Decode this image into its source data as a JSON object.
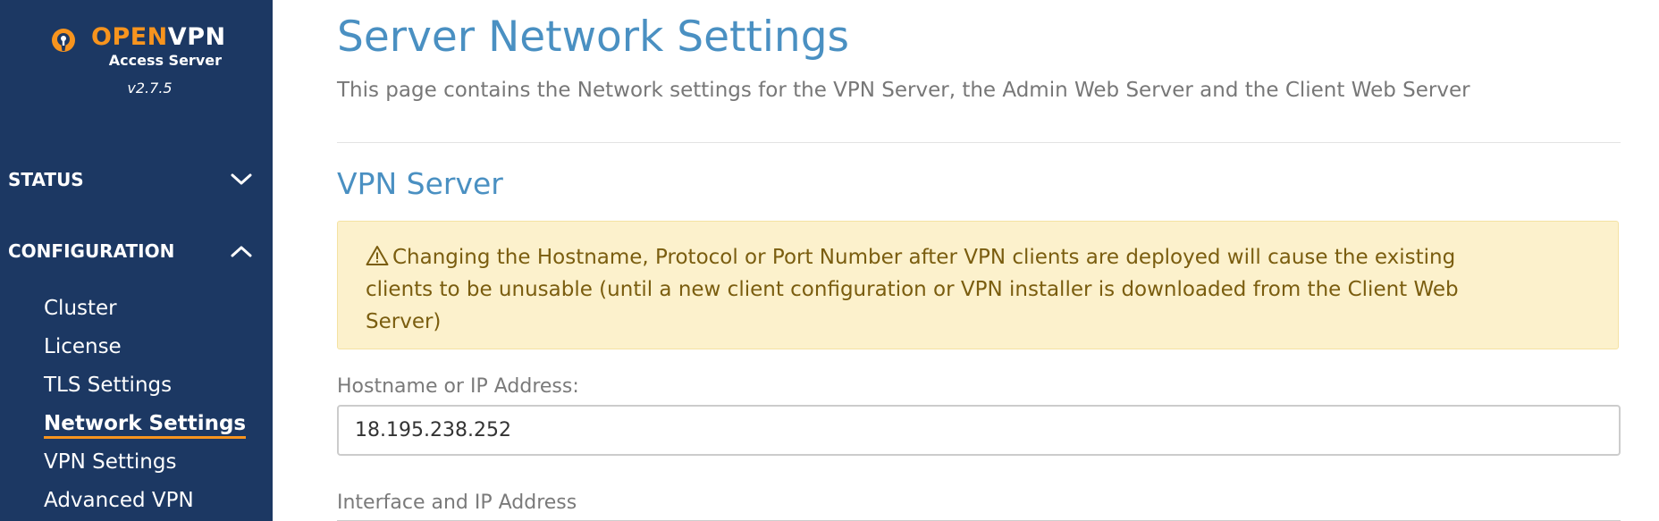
{
  "sidebar": {
    "brand": {
      "open": "OPEN",
      "vpn": "VPN",
      "subtitle": "Access Server",
      "version": "v2.7.5"
    },
    "sections": [
      {
        "label": "STATUS",
        "expanded": false
      },
      {
        "label": "CONFIGURATION",
        "expanded": true
      }
    ],
    "items": [
      {
        "label": "Cluster"
      },
      {
        "label": "License"
      },
      {
        "label": "TLS Settings"
      },
      {
        "label": "Network Settings",
        "active": true
      },
      {
        "label": "VPN Settings"
      },
      {
        "label": "Advanced VPN"
      }
    ]
  },
  "main": {
    "title": "Server Network Settings",
    "description": "This page contains the Network settings for the VPN Server, the Admin Web Server and the Client Web Server",
    "section_title": "VPN Server",
    "alert": {
      "icon": "warning-icon",
      "line1": "Changing the Hostname, Protocol or Port Number after VPN clients are deployed will cause the existing",
      "line2": "clients to be unusable (until a new client configuration or VPN installer is downloaded from the Client Web",
      "line3": "Server)"
    },
    "hostname": {
      "label": "Hostname or IP Address:",
      "value": "18.195.238.252"
    },
    "interface": {
      "label": "Interface and IP Address"
    }
  },
  "colors": {
    "sidebar_bg": "#1c3863",
    "accent_orange": "#f7941e",
    "heading_blue": "#4a90c2",
    "alert_bg": "#fcf1cc",
    "alert_text": "#7a5d0f"
  }
}
